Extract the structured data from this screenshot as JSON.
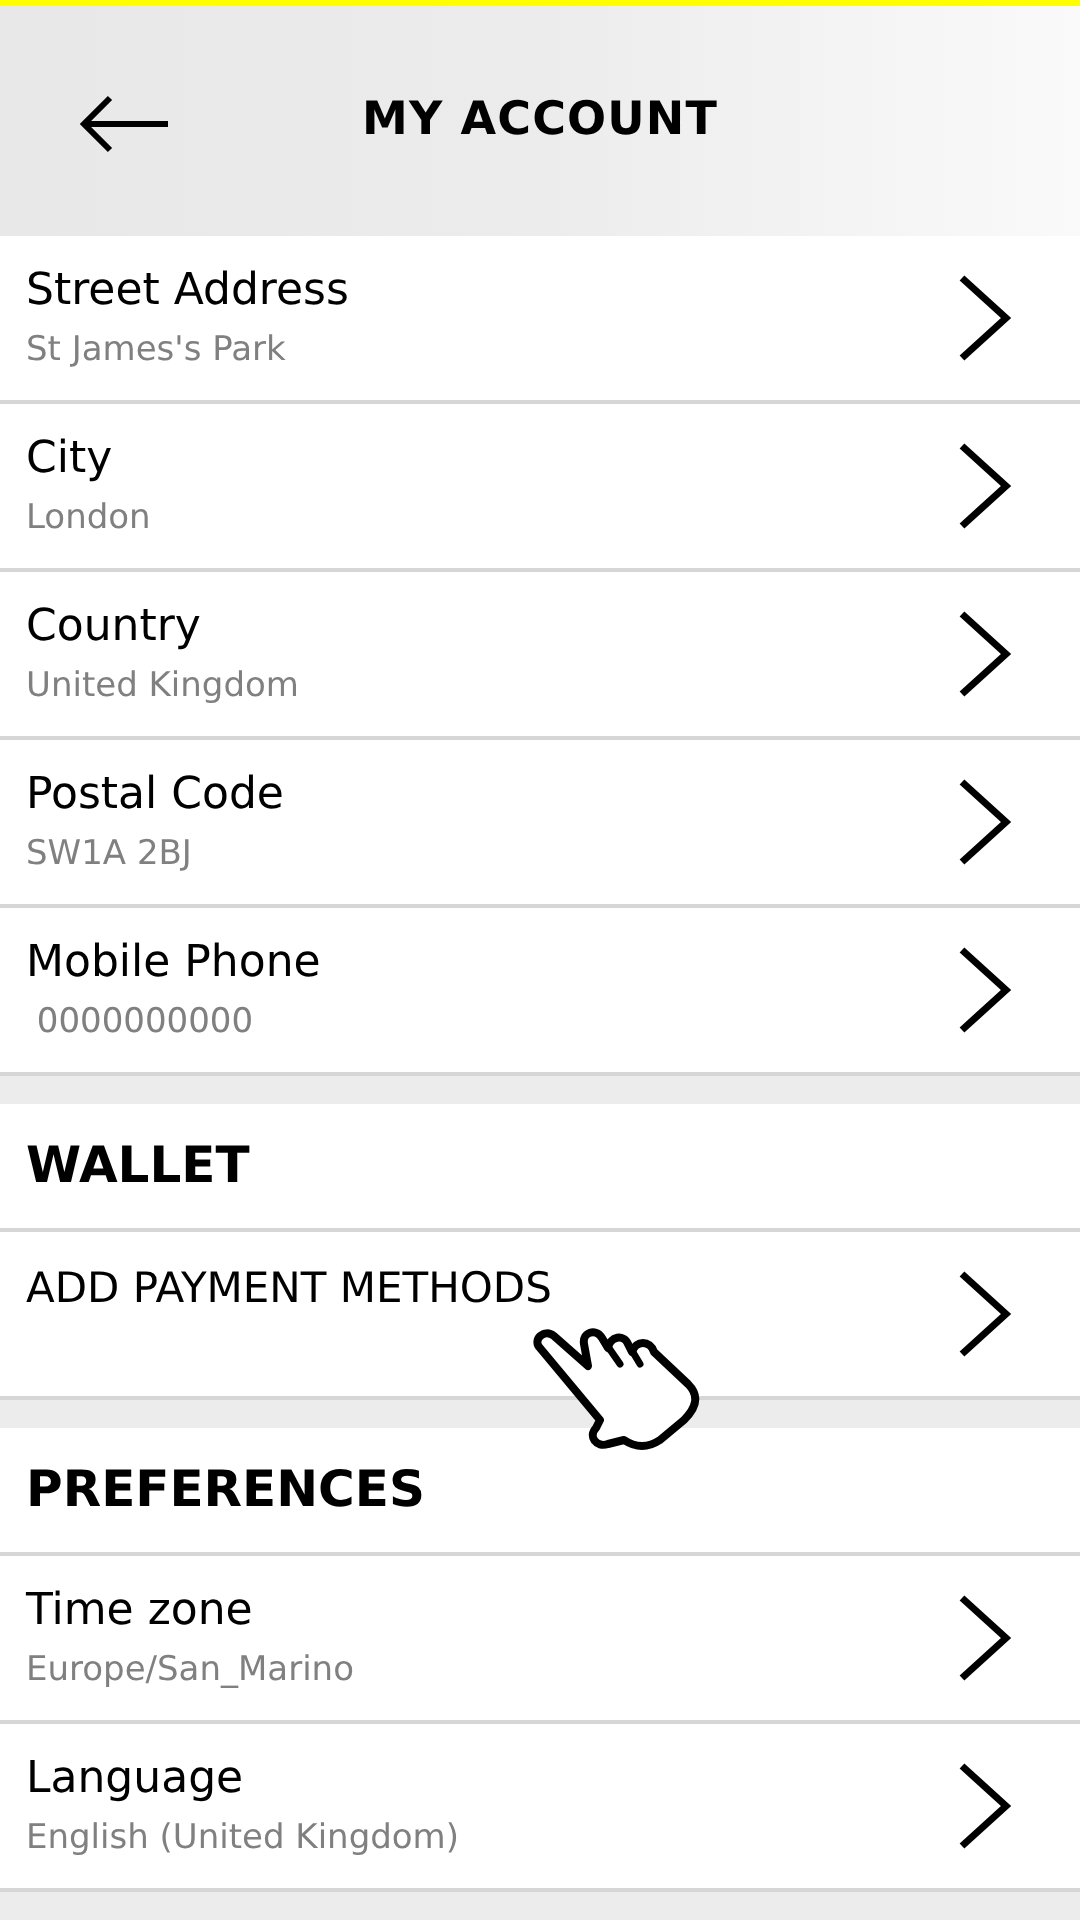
{
  "header": {
    "title": "MY ACCOUNT"
  },
  "sections": [
    {
      "kind": "fields",
      "items": [
        {
          "label": "Street Address",
          "value": "St James's Park"
        },
        {
          "label": "City",
          "value": "London"
        },
        {
          "label": "Country",
          "value": "United Kingdom"
        },
        {
          "label": "Postal Code",
          "value": "SW1A 2BJ"
        },
        {
          "label": "Mobile Phone",
          "value": " 0000000000"
        }
      ]
    },
    {
      "kind": "actions",
      "title": "WALLET",
      "items": [
        {
          "label": "ADD PAYMENT METHODS"
        }
      ]
    },
    {
      "kind": "fields",
      "title": "PREFERENCES",
      "items": [
        {
          "label": "Time zone",
          "value": "Europe/San_Marino"
        },
        {
          "label": "Language",
          "value": "English (United Kingdom)"
        }
      ]
    }
  ]
}
